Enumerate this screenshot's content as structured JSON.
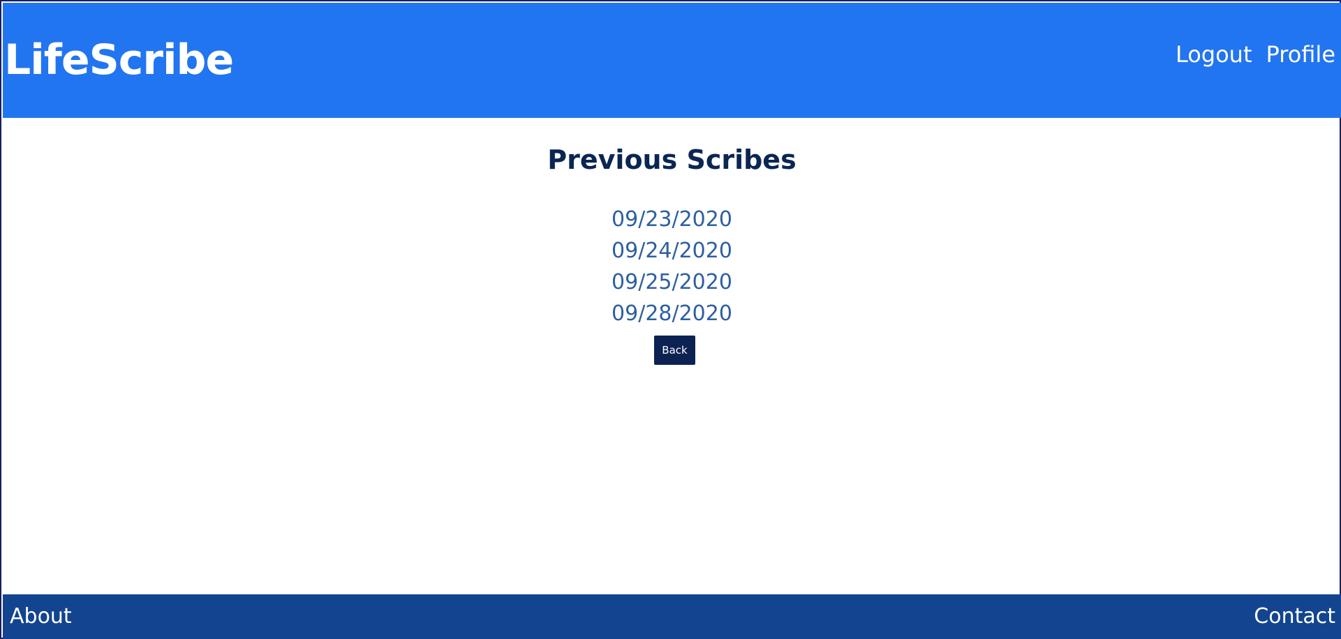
{
  "header": {
    "brand": "LifeScribe",
    "nav": [
      "Logout",
      "Profile"
    ]
  },
  "main": {
    "title": "Previous Scribes",
    "dates": [
      "09/23/2020",
      "09/24/2020",
      "09/25/2020",
      "09/28/2020"
    ],
    "back_label": "Back"
  },
  "footer": {
    "about": "About",
    "contact": "Contact"
  },
  "colors": {
    "header_bg": "#2275f0",
    "footer_bg": "#12448f",
    "title_color": "#0a2653",
    "date_link_color": "#2e5fa0",
    "button_bg": "#0b2252"
  }
}
